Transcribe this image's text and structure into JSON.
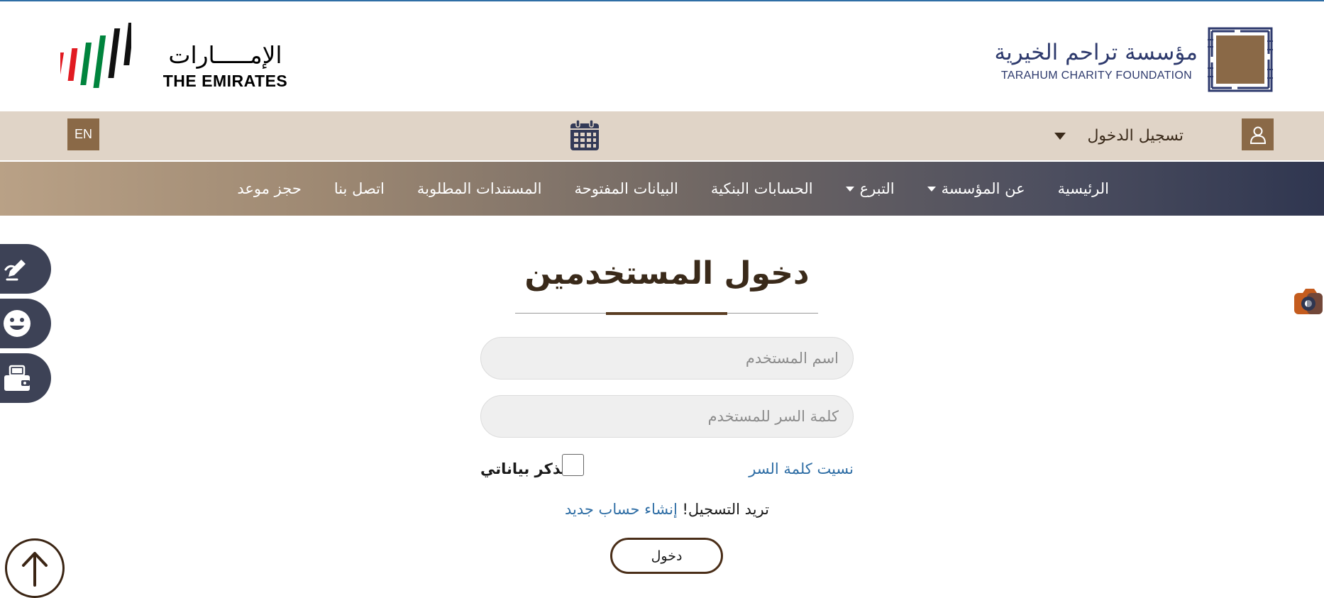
{
  "colors": {
    "accent_brown": "#8a6947",
    "utility_bg": "#e0d4c7",
    "link_blue": "#2f6ea5",
    "navy": "#2e3a6d",
    "side_button_bg": "#3d4256"
  },
  "header": {
    "emirates_logo": {
      "arabic": "الإمـــــارات",
      "english": "THE EMIRATES"
    },
    "foundation_logo": {
      "arabic": "مؤسسة تراحم الخيرية",
      "english": "TARAHUM CHARITY FOUNDATION"
    }
  },
  "utility_bar": {
    "language_button": "EN",
    "calendar_icon": "calendar-icon",
    "login_label": "تسجيل الدخول",
    "user_icon": "user-icon"
  },
  "nav": {
    "items": [
      {
        "label": "الرئيسية",
        "has_dropdown": false
      },
      {
        "label": "عن المؤسسة",
        "has_dropdown": true
      },
      {
        "label": "التبرع",
        "has_dropdown": true
      },
      {
        "label": "الحسابات البنكية",
        "has_dropdown": false
      },
      {
        "label": "البيانات المفتوحة",
        "has_dropdown": false
      },
      {
        "label": "المستندات المطلوبة",
        "has_dropdown": false
      },
      {
        "label": "اتصل بنا",
        "has_dropdown": false
      },
      {
        "label": "حجز موعد",
        "has_dropdown": false
      }
    ]
  },
  "side_buttons": {
    "icons": [
      "pen-hand-icon",
      "smiley-icon",
      "wallet-icon"
    ]
  },
  "login_form": {
    "title": "دخول المستخدمين",
    "username_placeholder": "اسم المستخدم",
    "password_placeholder": "كلمة السر للمستخدم",
    "forgot_password": "نسيت كلمة السر",
    "remember_me": "تذكر بياناتي",
    "register_prompt": "تريد التسجيل!",
    "register_link": "إنشاء حساب جديد",
    "submit_label": "دخول"
  }
}
